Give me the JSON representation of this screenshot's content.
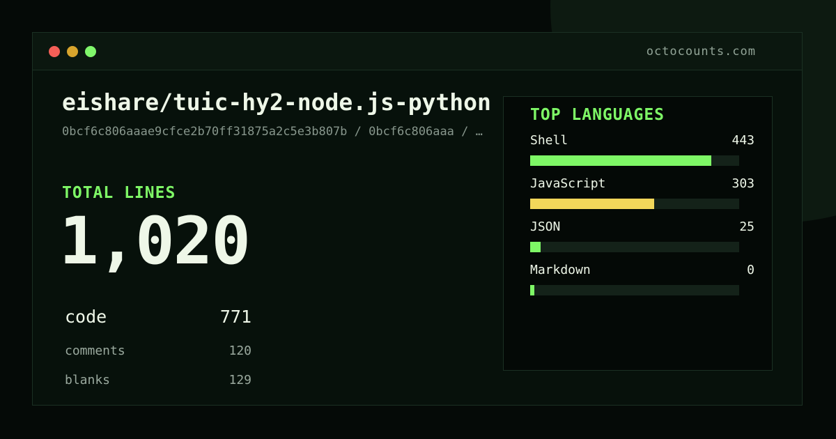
{
  "window": {
    "site": "octocounts.com"
  },
  "repo": {
    "title": "eishare/tuic-hy2-node.js-python",
    "subtitle": "0bcf6c806aaae9cfce2b70ff31875a2c5e3b807b / 0bcf6c806aaa / …"
  },
  "totals": {
    "label": "TOTAL LINES",
    "value": "1,020"
  },
  "stats": [
    {
      "label": "code",
      "value": "771"
    },
    {
      "label": "comments",
      "value": "120"
    },
    {
      "label": "blanks",
      "value": "129"
    }
  ],
  "languages": {
    "title": "TOP LANGUAGES",
    "items": [
      {
        "name": "Shell",
        "value": "443",
        "fraction": 0.867,
        "color": "#7ef766"
      },
      {
        "name": "JavaScript",
        "value": "303",
        "fraction": 0.593,
        "color": "#f2d75a"
      },
      {
        "name": "JSON",
        "value": "25",
        "fraction": 0.05,
        "color": "#7ef766"
      },
      {
        "name": "Markdown",
        "value": "0",
        "fraction": 0.02,
        "color": "#7ef766"
      }
    ]
  },
  "colors": {
    "accent": "#7ef766",
    "secondary_accent": "#f2d75a",
    "window_close": "#f45f57",
    "window_minimize": "#d9a52d",
    "window_maximize": "#80f76b"
  }
}
